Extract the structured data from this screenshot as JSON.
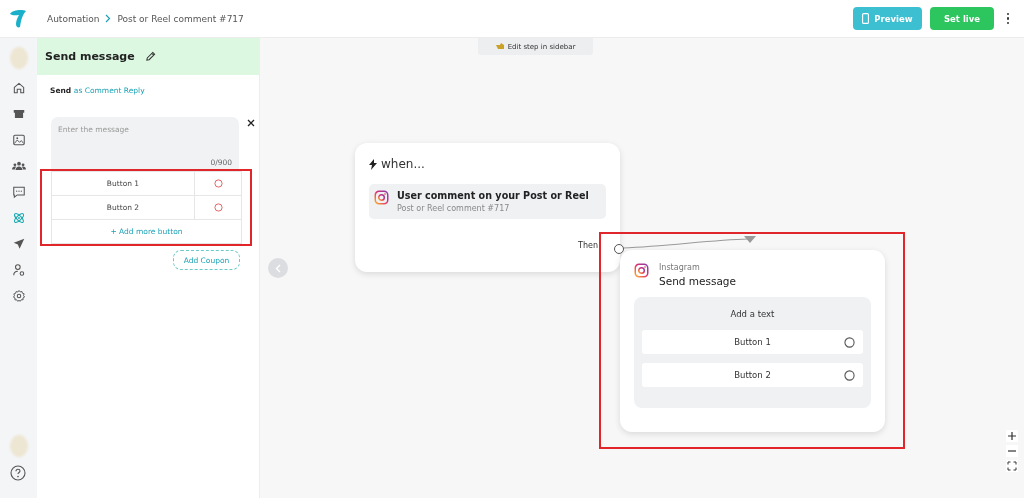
{
  "breadcrumb": [
    {
      "label": "Automation"
    },
    {
      "label": "Post or Reel comment #717"
    }
  ],
  "actions": {
    "preview": "Preview",
    "set_live": "Set live"
  },
  "nav_items": [
    {
      "kind": "avatar",
      "selected": false
    },
    {
      "kind": "home",
      "selected": false
    },
    {
      "kind": "store",
      "selected": false
    },
    {
      "kind": "image",
      "selected": false
    },
    {
      "kind": "users",
      "selected": false
    },
    {
      "kind": "chat",
      "selected": false
    },
    {
      "kind": "atom",
      "selected": true
    },
    {
      "kind": "send",
      "selected": false
    },
    {
      "kind": "user-gear",
      "selected": false
    },
    {
      "kind": "gear",
      "selected": false
    }
  ],
  "panel": {
    "title": "Send message",
    "send_prefix": "Send",
    "send_mode": "as Comment Reply",
    "message": {
      "placeholder": "Enter the message",
      "counter": "0/900"
    },
    "buttons": [
      {
        "label": "Button 1"
      },
      {
        "label": "Button 2"
      }
    ],
    "add_button": "+ Add more button",
    "add_coupon": "Add Coupon"
  },
  "canvas": {
    "hint": "Edit step in sidebar",
    "trigger": {
      "heading": "when...",
      "title": "User comment on your Post or Reel",
      "subtitle": "Post or Reel comment #717",
      "then": "Then"
    },
    "action": {
      "platform": "Instagram",
      "title": "Send message",
      "text": "Add a text",
      "buttons": [
        {
          "label": "Button 1"
        },
        {
          "label": "Button 2"
        }
      ]
    }
  }
}
